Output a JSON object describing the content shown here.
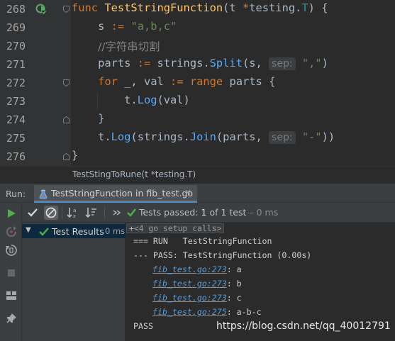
{
  "editor": {
    "lines": [
      {
        "num": "268",
        "tokens": [
          [
            "kw",
            "func "
          ],
          [
            "fn",
            "TestStringFunction"
          ],
          [
            "p",
            "(t "
          ],
          [
            "kw",
            "*"
          ],
          [
            "p",
            "testing."
          ],
          [
            "typ",
            "T"
          ],
          [
            "p",
            ") {"
          ]
        ]
      },
      {
        "num": "269",
        "tokens": [
          [
            "p",
            "    s "
          ],
          [
            "kw",
            ":="
          ],
          [
            "p",
            " "
          ],
          [
            "str",
            "\"a,b,c\""
          ]
        ]
      },
      {
        "num": "270",
        "tokens": [
          [
            "p",
            "    "
          ],
          [
            "cmt",
            "//字符串切割"
          ]
        ]
      },
      {
        "num": "271",
        "tokens": [
          [
            "p",
            "    parts "
          ],
          [
            "kw",
            ":="
          ],
          [
            "p",
            " strings."
          ],
          [
            "call",
            "Split"
          ],
          [
            "p",
            "(s, "
          ],
          [
            "hint",
            "sep:"
          ],
          [
            "p",
            " "
          ],
          [
            "str",
            "\",\""
          ],
          [
            "p",
            ")"
          ]
        ]
      },
      {
        "num": "272",
        "tokens": [
          [
            "p",
            "    "
          ],
          [
            "kw",
            "for"
          ],
          [
            "p",
            " _, val "
          ],
          [
            "kw",
            ":="
          ],
          [
            "p",
            " "
          ],
          [
            "kw",
            "range"
          ],
          [
            "p",
            " parts {"
          ]
        ]
      },
      {
        "num": "273",
        "tokens": [
          [
            "p",
            "        t."
          ],
          [
            "call",
            "Log"
          ],
          [
            "p",
            "(val)"
          ]
        ]
      },
      {
        "num": "274",
        "tokens": [
          [
            "p",
            "    }"
          ]
        ]
      },
      {
        "num": "275",
        "tokens": [
          [
            "p",
            "    t."
          ],
          [
            "call",
            "Log"
          ],
          [
            "p",
            "(strings."
          ],
          [
            "call",
            "Join"
          ],
          [
            "p",
            "(parts, "
          ],
          [
            "hint",
            "sep:"
          ],
          [
            "p",
            " "
          ],
          [
            "str",
            "\"-\""
          ],
          [
            "p",
            "))"
          ]
        ]
      },
      {
        "num": "276",
        "tokens": [
          [
            "p",
            "}"
          ]
        ]
      }
    ]
  },
  "breadcrumb": {
    "text": "TestStingToRune(t *testing.T)"
  },
  "run_panel": {
    "label": "Run:",
    "tab_label": "TestStringFunction in fib_test.go",
    "tab_close": "×",
    "status": {
      "prefix": "Tests passed:",
      "count": "1",
      "middle": "of 1 test",
      "time": "– 0 ms"
    },
    "tree": {
      "label": "Test Results",
      "time": "0 ms"
    },
    "console": {
      "setup_calls": "<4 go setup calls>",
      "lines": [
        {
          "text": "=== RUN   TestStringFunction"
        },
        {
          "text": "--- PASS: TestStringFunction (0.00s)"
        },
        {
          "link": "fib_test.go:273",
          "rest": ": a"
        },
        {
          "link": "fib_test.go:273",
          "rest": ": b"
        },
        {
          "link": "fib_test.go:273",
          "rest": ": c"
        },
        {
          "link": "fib_test.go:275",
          "rest": ": a-b-c"
        },
        {
          "text": "PASS"
        }
      ]
    }
  },
  "watermark": "https://blog.csdn.net/qq_40012791",
  "colors": {
    "editor_bg": "#2b2b2b",
    "panel_bg": "#3c3f41",
    "pass_green": "#4fb04b",
    "keyword": "#cc7832",
    "function": "#ffc66d",
    "string": "#6a8759"
  }
}
